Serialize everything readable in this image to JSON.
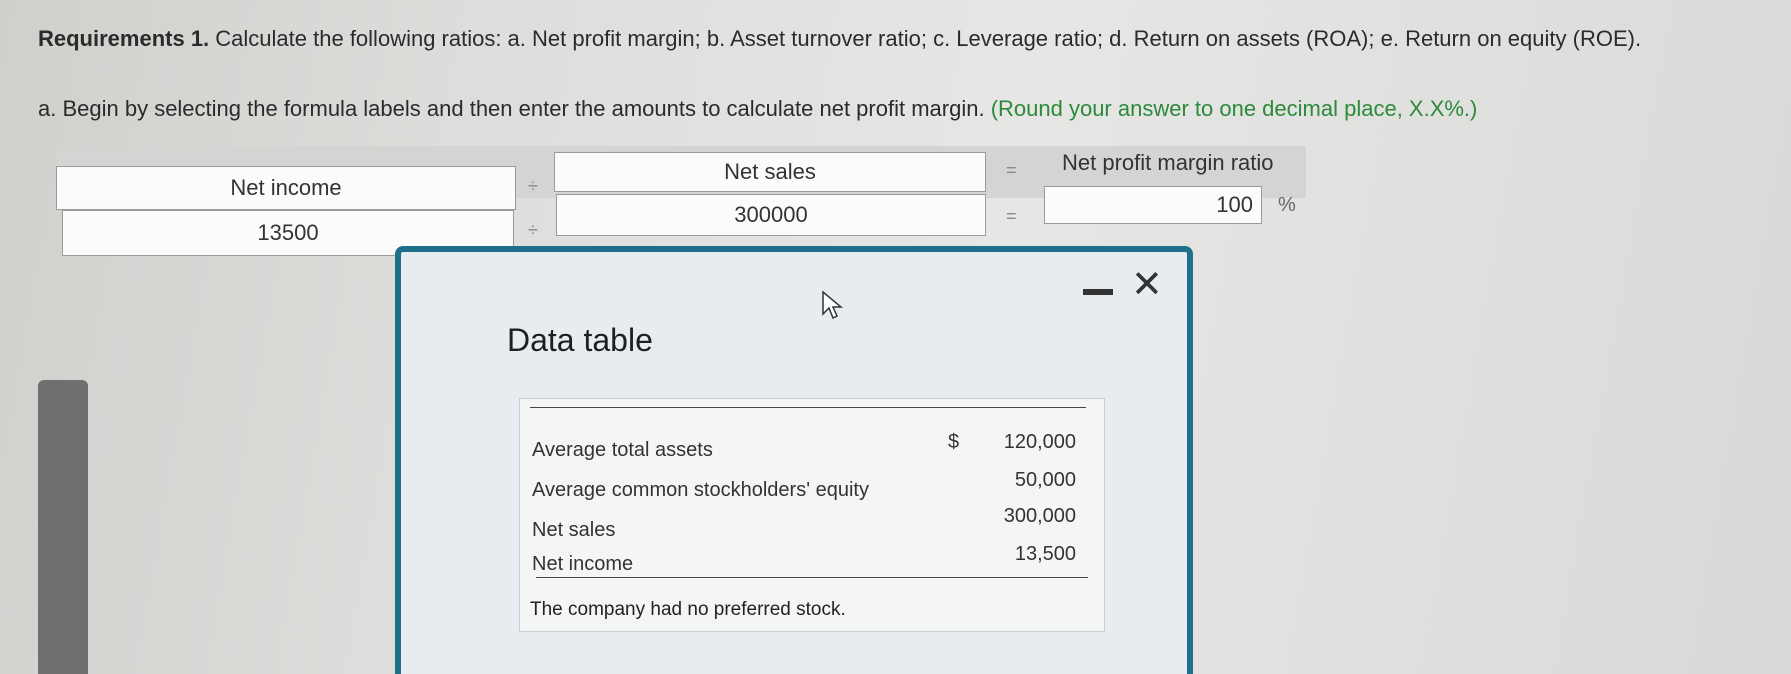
{
  "requirements": {
    "heading": "Requirements 1.",
    "text": "Calculate the following ratios: a. Net profit margin; b. Asset turnover ratio; c. Leverage ratio; d. Return on assets (ROA); e. Return on equity (ROE)."
  },
  "part_a": {
    "instruction": "a. Begin by selecting the formula labels and then enter the amounts to calculate net profit margin.",
    "hint": "(Round your answer to one decimal place, X.X%.)"
  },
  "formula": {
    "label_numerator": "Net income",
    "divide_symbol": "÷",
    "label_denominator": "Net sales",
    "equals_symbol": "=",
    "result_label": "Net profit margin ratio",
    "value_numerator": "13500",
    "value_denominator": "300000",
    "result_value": "100",
    "percent_symbol": "%"
  },
  "dialog": {
    "title": "Data table",
    "close_icon": "close-icon",
    "minimize_icon": "minimize-icon",
    "currency": "$",
    "rows": [
      {
        "label": "Average total assets",
        "value": "120,000"
      },
      {
        "label": "Average common stockholders' equity",
        "value": "50,000"
      },
      {
        "label": "Net sales",
        "value": "300,000"
      },
      {
        "label": "Net income",
        "value": "13,500"
      }
    ],
    "note": "The company had no preferred stock."
  },
  "colors": {
    "dialog_border": "#1f6f8b",
    "hint_green": "#2c8a3a"
  }
}
